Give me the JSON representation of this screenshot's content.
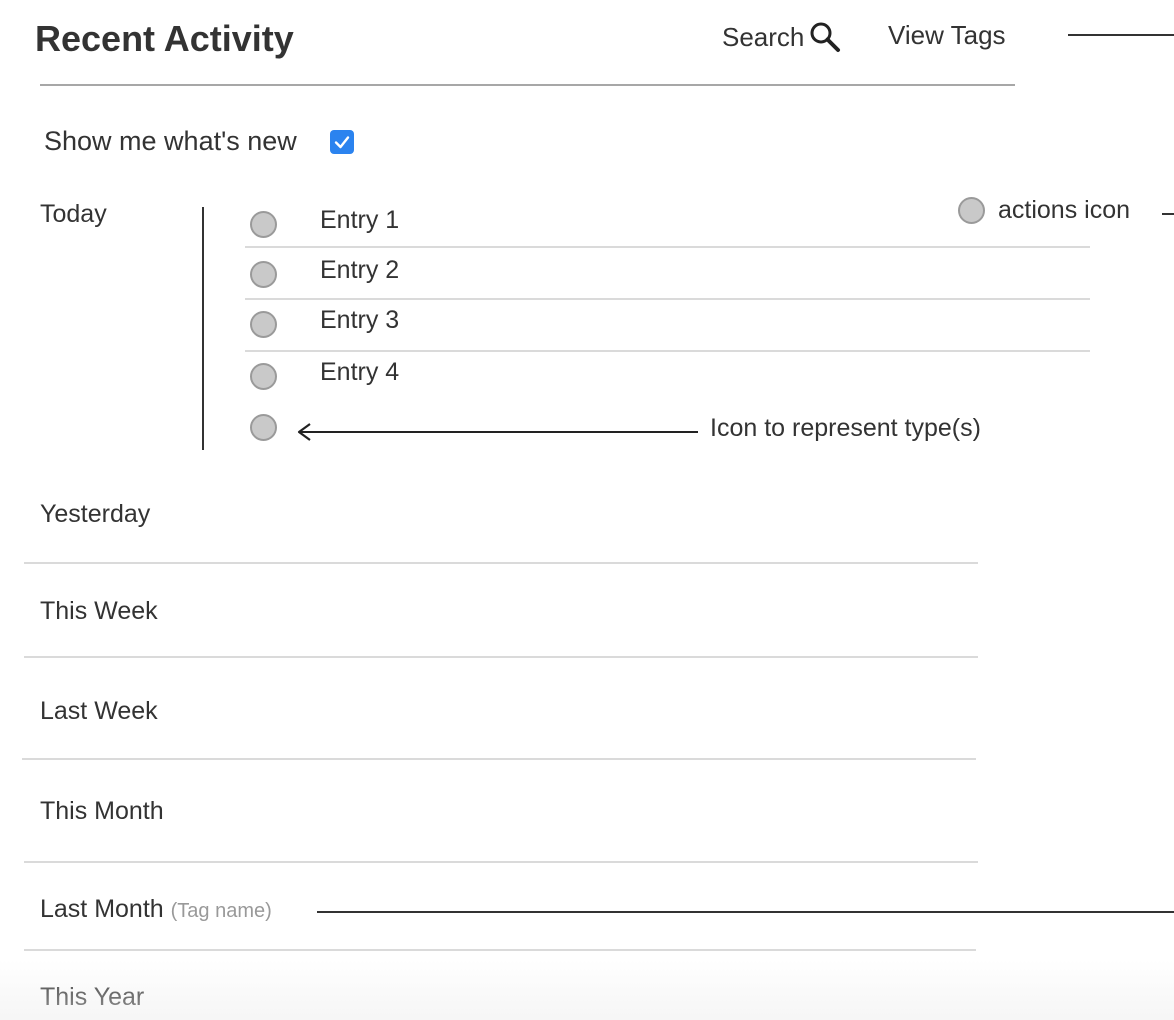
{
  "header": {
    "title": "Recent Activity",
    "search_label": "Search",
    "search_icon": "magnifier",
    "view_tags_label": "View Tags"
  },
  "filter": {
    "show_new_label": "Show me what's new",
    "show_new_checked": true,
    "checkbox_color": "#2b83ef"
  },
  "today": {
    "label": "Today",
    "entries": [
      "Entry 1",
      "Entry 2",
      "Entry 3",
      "Entry 4"
    ],
    "actions_annotation": "actions icon",
    "type_icon_annotation": "Icon to represent type(s)"
  },
  "sections": {
    "yesterday": "Yesterday",
    "this_week": "This Week",
    "last_week": "Last Week",
    "this_month": "This Month",
    "last_month": "Last Month",
    "last_month_tag": "(Tag name)",
    "this_year": "This Year"
  }
}
